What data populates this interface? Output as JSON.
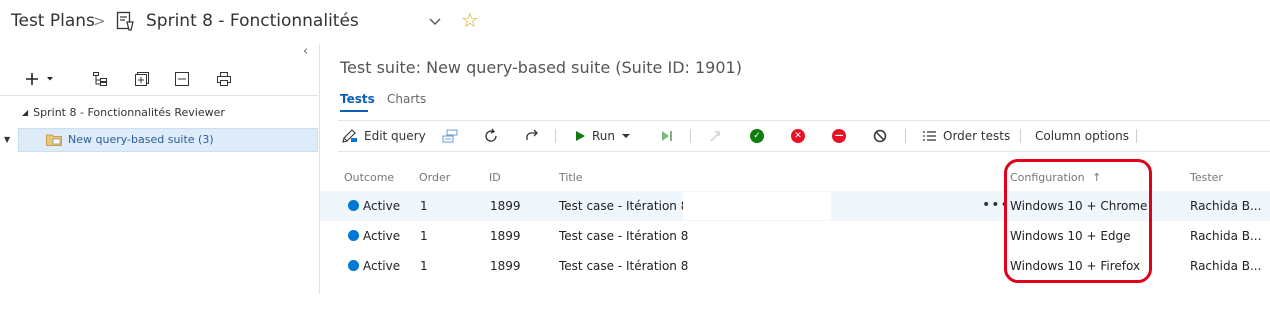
{
  "header": {
    "breadcrumb_root": "Test Plans",
    "separator": ">",
    "plan_name": "Sprint 8 - Fonctionnalités",
    "favorite_icon": "star-icon",
    "star_color": "#d9a81a"
  },
  "left_pane": {
    "collapse_glyph": "‹",
    "toolbar": [
      "add-icon",
      "tree-icon",
      "new-suite-icon",
      "collapse-all-icon",
      "print-icon"
    ],
    "tree": {
      "root_label": "Sprint 8 - Fonctionnalités Reviewer",
      "selected_child_label": "New query-based suite (3)"
    }
  },
  "main": {
    "suite_title": "Test suite: New query-based suite (Suite ID: 1901)",
    "tabs": [
      {
        "label": "Tests",
        "active": true
      },
      {
        "label": "Charts",
        "active": false
      }
    ],
    "toolbar": {
      "edit_query": "Edit query",
      "run": "Run",
      "order_tests": "Order tests",
      "column_options": "Column options"
    },
    "columns": {
      "outcome": "Outcome",
      "order": "Order",
      "id": "ID",
      "title": "Title",
      "configuration": "Configuration",
      "configuration_sort": "↑",
      "tester": "Tester"
    },
    "rows": [
      {
        "outcome": "Active",
        "order": "1",
        "id": "1899",
        "title": "Test case - Itération 8",
        "configuration": "Windows 10 + Chrome",
        "tester": "Rachida B..."
      },
      {
        "outcome": "Active",
        "order": "1",
        "id": "1899",
        "title": "Test case - Itération 8",
        "configuration": "Windows 10 + Edge",
        "tester": "Rachida B..."
      },
      {
        "outcome": "Active",
        "order": "1",
        "id": "1899",
        "title": "Test case - Itération 8",
        "configuration": "Windows 10 + Firefox",
        "tester": "Rachida B..."
      }
    ],
    "row_more": "•••",
    "colors": {
      "accent": "#0b5fb6",
      "active_dot": "#0078d4",
      "pass": "#107c10",
      "fail": "#e81123",
      "block": "#e81123",
      "annotation": "#e0001b"
    }
  }
}
